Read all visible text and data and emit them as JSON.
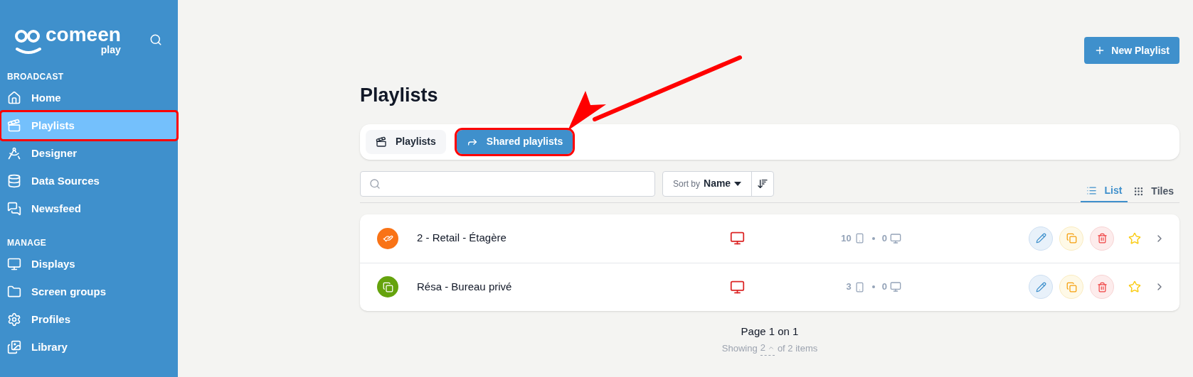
{
  "sidebar": {
    "logo": {
      "name": "comeen",
      "sub": "play"
    },
    "sections": [
      {
        "title": "BROADCAST",
        "items": [
          {
            "label": "Home",
            "selected": false,
            "highlighted": false
          },
          {
            "label": "Playlists",
            "selected": true,
            "highlighted": true
          },
          {
            "label": "Designer",
            "selected": false,
            "highlighted": false
          },
          {
            "label": "Data Sources",
            "selected": false,
            "highlighted": false
          },
          {
            "label": "Newsfeed",
            "selected": false,
            "highlighted": false
          }
        ]
      },
      {
        "title": "MANAGE",
        "items": [
          {
            "label": "Displays",
            "selected": false,
            "highlighted": false
          },
          {
            "label": "Screen groups",
            "selected": false,
            "highlighted": false
          },
          {
            "label": "Profiles",
            "selected": false,
            "highlighted": false
          },
          {
            "label": "Library",
            "selected": false,
            "highlighted": false
          }
        ]
      }
    ]
  },
  "new_button": "New Playlist",
  "title": "Playlists",
  "tabs": [
    {
      "label": "Playlists",
      "selected": false,
      "highlighted": false
    },
    {
      "label": "Shared playlists",
      "selected": true,
      "highlighted": true
    }
  ],
  "callout_arrow": true,
  "sort": {
    "prefix": "Sort by",
    "value": "Name"
  },
  "views": [
    {
      "label": "List",
      "selected": true
    },
    {
      "label": "Tiles",
      "selected": false
    }
  ],
  "rows": [
    {
      "name": "2 - Retail - Étagère",
      "color": "#f97316",
      "items": "10",
      "displays": "0"
    },
    {
      "name": "Résa - Bureau privé",
      "color": "#65a30d",
      "items": "3",
      "displays": "0"
    }
  ],
  "pagination": {
    "page": "Page 1 on 1",
    "prefix": "Showing",
    "size": "2",
    "suffix": "of 2 items"
  }
}
